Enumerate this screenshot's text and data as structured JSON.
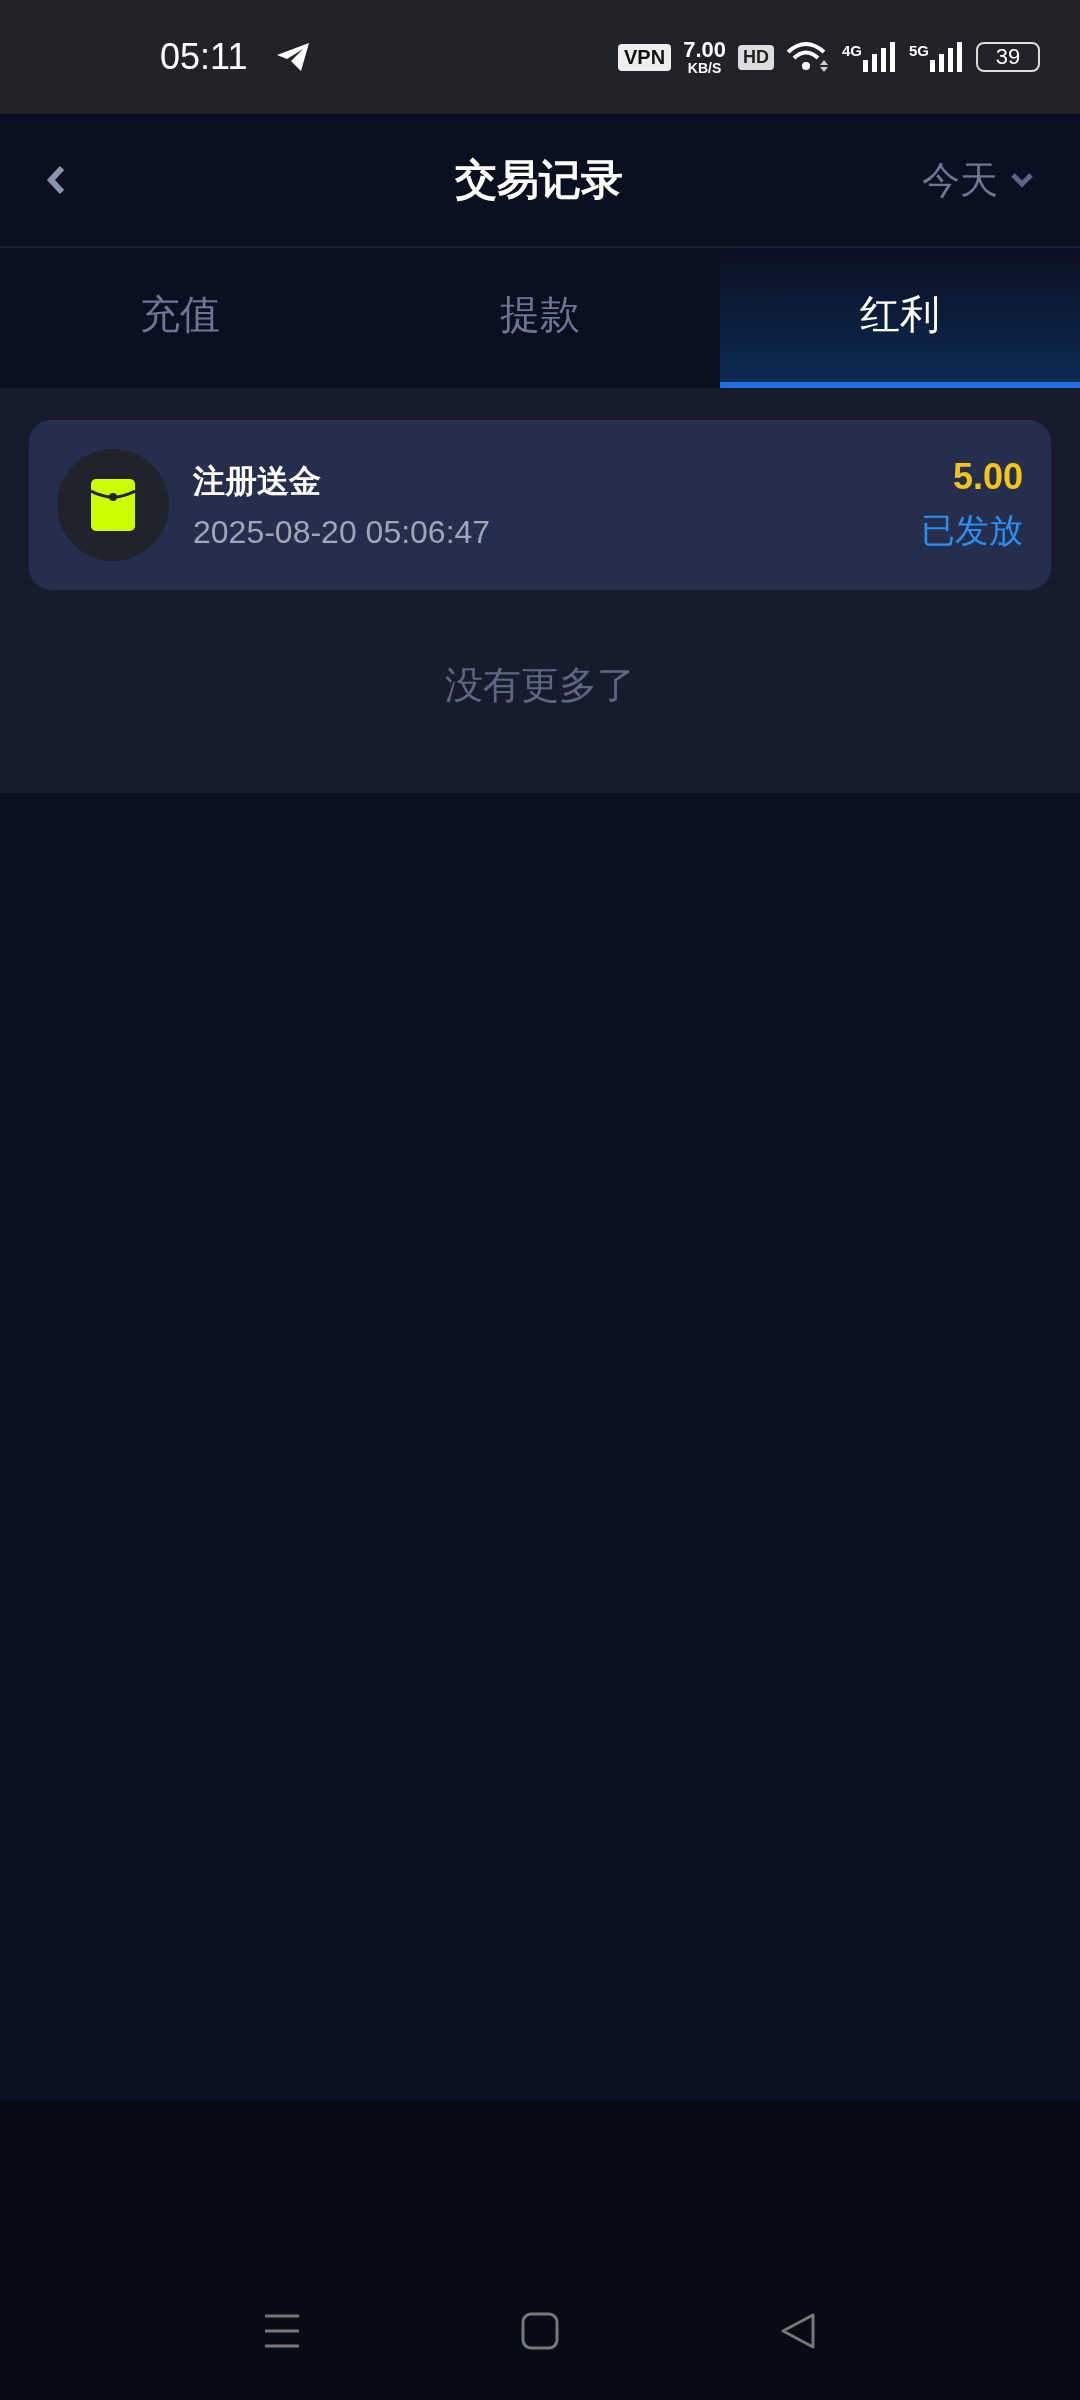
{
  "status_bar": {
    "time": "05:11",
    "vpn": "VPN",
    "speed": "7.00",
    "speed_unit": "KB/S",
    "hd": "HD",
    "network_1": "4G",
    "network_2": "5G",
    "battery": "39"
  },
  "header": {
    "title": "交易记录",
    "filter": "今天"
  },
  "tabs": [
    {
      "label": "充值",
      "selected": false
    },
    {
      "label": "提款",
      "selected": false
    },
    {
      "label": "红利",
      "selected": true
    }
  ],
  "records": [
    {
      "title": "注册送金",
      "time": "2025-08-20 05:06:47",
      "amount": "5.00",
      "status": "已发放"
    }
  ],
  "end_text": "没有更多了"
}
